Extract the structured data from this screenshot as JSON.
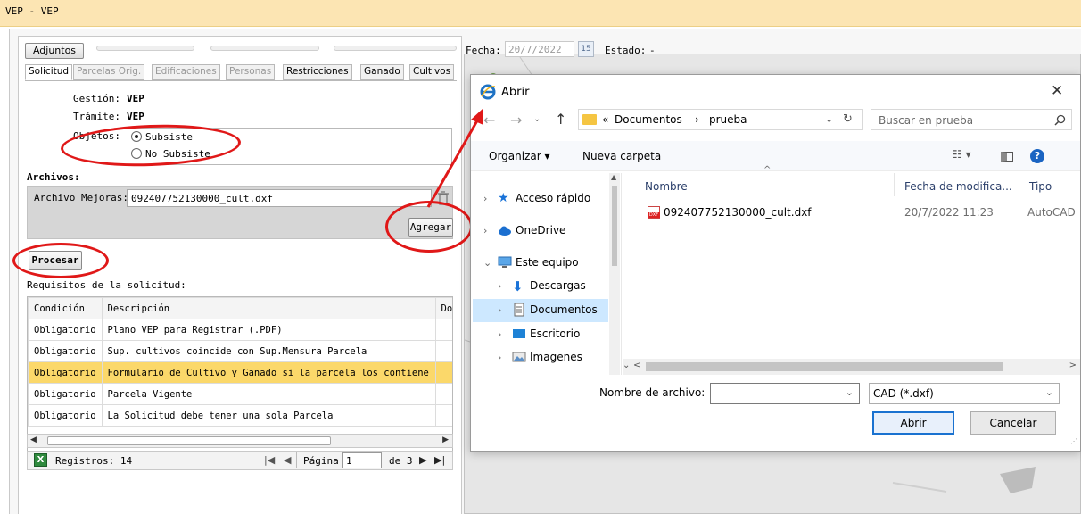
{
  "window": {
    "title": "VEP - VEP"
  },
  "header": {
    "fecha_label": "Fecha:",
    "fecha_value": "20/7/2022",
    "calendar_day": "15",
    "estado_label": "Estado:",
    "estado_value": "-"
  },
  "tabs": {
    "adjuntos": "Adjuntos",
    "items": [
      "Solicitud",
      "Parcelas Orig.",
      "Edificaciones",
      "Personas",
      "Restricciones",
      "Ganado",
      "Cultivos"
    ]
  },
  "form": {
    "gestion_label": "Gestión:",
    "gestion_value": "VEP",
    "tramite_label": "Trámite:",
    "tramite_value": "VEP",
    "objetos_label": "Objetos:",
    "option_subsiste": "Subsiste",
    "option_no_subsiste": "No Subsiste",
    "archivos_heading": "Archivos:",
    "archivo_mejoras_label": "Archivo Mejoras:",
    "archivo_mejoras_value": "092407752130000_cult.dxf",
    "agregar_button": "Agregar",
    "procesar_button": "Procesar",
    "requisitos_label": "Requisitos de la solicitud:"
  },
  "requirements": {
    "columns": [
      "Condición",
      "Descripción",
      "Doc"
    ],
    "rows": [
      {
        "condicion": "Obligatorio",
        "descripcion": "Plano VEP para Registrar (.PDF)"
      },
      {
        "condicion": "Obligatorio",
        "descripcion": "Sup. cultivos coincide con Sup.Mensura Parcela"
      },
      {
        "condicion": "Obligatorio",
        "descripcion": "Formulario de Cultivo y Ganado si la parcela los contiene"
      },
      {
        "condicion": "Obligatorio",
        "descripcion": "Parcela Vigente"
      },
      {
        "condicion": "Obligatorio",
        "descripcion": "La Solicitud debe tener una sola Parcela"
      }
    ],
    "registros": "Registros: 14",
    "pagina_label": "Página",
    "pagina_value": "1",
    "de_label": "de 3"
  },
  "dialog": {
    "title": "Abrir",
    "path_prefix": "«",
    "path_1": "Documentos",
    "path_sep": "›",
    "path_2": "prueba",
    "search_placeholder": "Buscar en prueba",
    "organizar": "Organizar ▾",
    "nueva_carpeta": "Nueva carpeta",
    "tree": [
      "Acceso rápido",
      "OneDrive",
      "Este equipo",
      "Descargas",
      "Documentos",
      "Escritorio",
      "Imagenes"
    ],
    "columns": [
      "Nombre",
      "Fecha de modifica...",
      "Tipo"
    ],
    "files": [
      {
        "name": "092407752130000_cult.dxf",
        "date": "20/7/2022 11:23",
        "type": "AutoCAD"
      }
    ],
    "file_icon_label": "DXF",
    "filename_label": "Nombre de archivo:",
    "filename_value": "",
    "filter_value": "CAD (*.dxf)",
    "open_button": "Abrir",
    "cancel_button": "Cancelar"
  },
  "colors": {
    "titlebar": "#fce5b3",
    "selected_row": "#fbd86a",
    "annotation": "#e01818"
  }
}
